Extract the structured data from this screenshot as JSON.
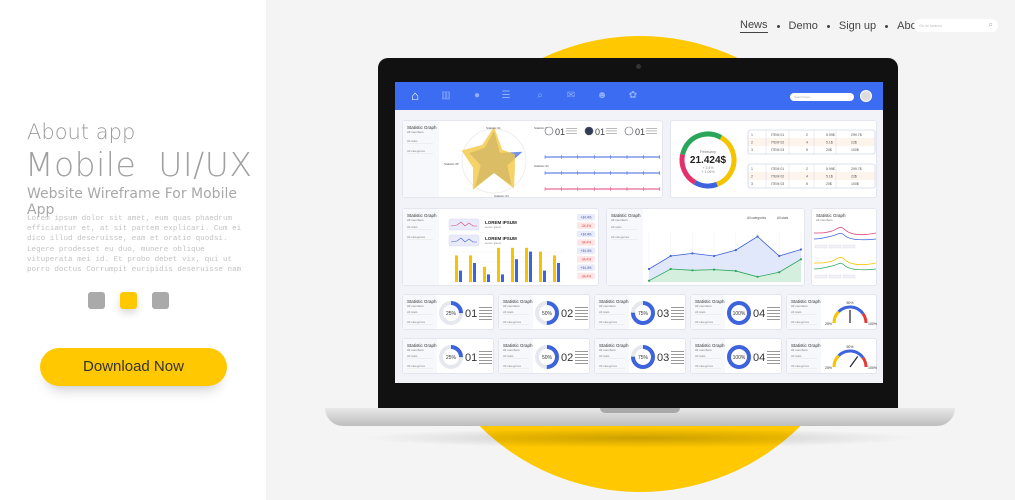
{
  "hero": {
    "kicker": "About app",
    "title": "Mobile  UI/UX",
    "subtitle": "Website Wireframe For Mobile App",
    "body": "Lorem ipsum dolor sit amet, eum quas phaedrum efficiantur et, at sit partem explicari. Cum ei dico illud deseruisse, eam et oratio quodsi. Legere prodesset eu duo, munere oblique vituperata mei id. Et probo debet vix, qui ut porro doctus  Corrumpit euripidis deseruisse nam",
    "download_label": "Download Now",
    "carousel_active": 2
  },
  "nav": {
    "items": [
      "News",
      "Demo",
      "Sign up",
      "About"
    ],
    "active": "News",
    "search_placeholder": "Go to search"
  },
  "colors": {
    "accent": "#ffc800",
    "header": "#3c6cf1",
    "blue": "#3d63dd",
    "green": "#2aa65a",
    "pink": "#e0457b"
  },
  "dashboard": {
    "header_icons": [
      "home-icon",
      "bar-chart-icon",
      "chat-icon",
      "inbox-icon",
      "search-icon",
      "mail-icon",
      "users-icon",
      "settings-icon"
    ],
    "search_placeholder": "Search here",
    "card_title": "Statistic Graph",
    "card_sub": "All members",
    "dd_all": "All stats",
    "dd_cat": "All categories",
    "radar": {
      "labels": [
        "Statistic 01",
        "Statistic 02",
        "Statistic 03",
        "Statistic 04",
        "Statistic 05"
      ]
    },
    "steps": [
      "01",
      "01",
      "01"
    ],
    "donut": {
      "label": "February",
      "value": "21.424$",
      "delta1": "+ 2.4%",
      "delta2": "+ 1.09%"
    },
    "table_rows": [
      [
        "1",
        "ITEM 01",
        "2",
        "5.99$",
        "299.7$"
      ],
      [
        "2",
        "ITEM 02",
        "4",
        "5.1$",
        "22$"
      ],
      [
        "3",
        "ITEM 03",
        "5",
        "20$",
        "100$"
      ]
    ],
    "lorem_title": "LOREM IPSUM",
    "lorem_sub": "Lorem ipsum",
    "badges": [
      "+34.4%",
      "-34.4%",
      "+34.4%",
      "-34.4%",
      "+34.4%",
      "-34.4%",
      "+34.4%",
      "-34.4%"
    ],
    "bars_yellow": [
      7,
      7,
      4,
      9,
      9,
      9,
      8,
      7
    ],
    "bars_blue": [
      3,
      5,
      2,
      2,
      6,
      8,
      3,
      5
    ],
    "area_blue": [
      2,
      4,
      4.4,
      4,
      4.9,
      7,
      4,
      5
    ],
    "area_green": [
      0.2,
      2,
      1.8,
      1.9,
      1.7,
      0.8,
      1.5,
      3.5
    ],
    "rings": [
      {
        "num": "01",
        "pct": 25
      },
      {
        "num": "02",
        "pct": 50
      },
      {
        "num": "03",
        "pct": 75
      },
      {
        "num": "04",
        "pct": 100
      }
    ],
    "gauge": {
      "min": "25%",
      "mid": "50%",
      "max": "100%",
      "values": [
        50,
        70
      ]
    }
  }
}
